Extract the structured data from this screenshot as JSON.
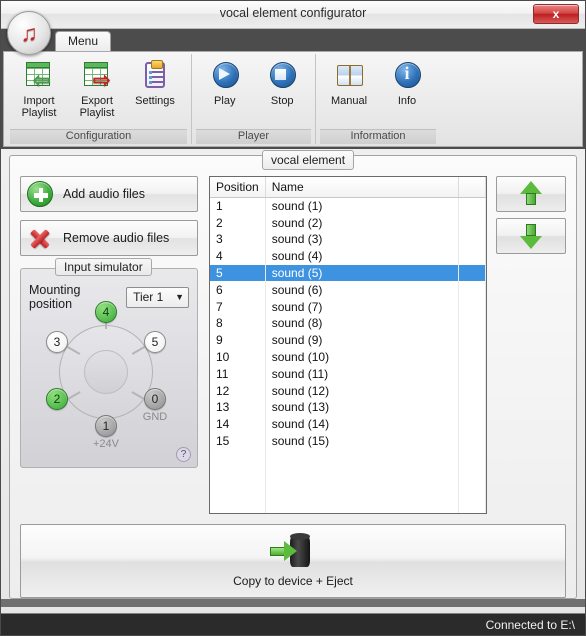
{
  "window": {
    "title": "vocal element configurator",
    "close_label": "x",
    "app_icon": "music-note-icon"
  },
  "ribbon": {
    "tab": "Menu",
    "groups": [
      {
        "title": "Configuration",
        "buttons": [
          {
            "label_line1": "Import",
            "label_line2": "Playlist",
            "icon": "import-playlist-icon"
          },
          {
            "label_line1": "Export",
            "label_line2": "Playlist",
            "icon": "export-playlist-icon"
          },
          {
            "label_line1": "Settings",
            "label_line2": "",
            "icon": "settings-clipboard-icon"
          }
        ]
      },
      {
        "title": "Player",
        "buttons": [
          {
            "label_line1": "Play",
            "label_line2": "",
            "icon": "play-icon"
          },
          {
            "label_line1": "Stop",
            "label_line2": "",
            "icon": "stop-icon"
          }
        ]
      },
      {
        "title": "Information",
        "buttons": [
          {
            "label_line1": "Manual",
            "label_line2": "",
            "icon": "book-icon"
          },
          {
            "label_line1": "Info",
            "label_line2": "",
            "icon": "info-icon"
          }
        ]
      }
    ]
  },
  "left_panel": {
    "add_button": "Add audio files",
    "remove_button": "Remove audio files",
    "input_simulator": {
      "legend": "Input simulator",
      "mounting_label": "Mounting position",
      "mounting_value": "Tier 1",
      "help_badge": "?",
      "nodes": [
        {
          "id": "4",
          "state": "on",
          "caption": ""
        },
        {
          "id": "3",
          "state": "off",
          "caption": ""
        },
        {
          "id": "5",
          "state": "off",
          "caption": ""
        },
        {
          "id": "2",
          "state": "on",
          "caption": ""
        },
        {
          "id": "0",
          "state": "gray",
          "caption": "GND"
        },
        {
          "id": "1",
          "state": "gray",
          "caption": "+24V"
        }
      ]
    }
  },
  "playlist": {
    "tab_caption": "vocal element",
    "columns": [
      "Position",
      "Name"
    ],
    "rows": [
      {
        "position": "1",
        "name": "sound (1)",
        "selected": false
      },
      {
        "position": "2",
        "name": "sound (2)",
        "selected": false
      },
      {
        "position": "3",
        "name": "sound (3)",
        "selected": false
      },
      {
        "position": "4",
        "name": "sound (4)",
        "selected": false
      },
      {
        "position": "5",
        "name": "sound (5)",
        "selected": true
      },
      {
        "position": "6",
        "name": "sound (6)",
        "selected": false
      },
      {
        "position": "7",
        "name": "sound (7)",
        "selected": false
      },
      {
        "position": "8",
        "name": "sound (8)",
        "selected": false
      },
      {
        "position": "9",
        "name": "sound (9)",
        "selected": false
      },
      {
        "position": "10",
        "name": "sound (10)",
        "selected": false
      },
      {
        "position": "11",
        "name": "sound (11)",
        "selected": false
      },
      {
        "position": "12",
        "name": "sound (12)",
        "selected": false
      },
      {
        "position": "13",
        "name": "sound (13)",
        "selected": false
      },
      {
        "position": "14",
        "name": "sound (14)",
        "selected": false
      },
      {
        "position": "15",
        "name": "sound (15)",
        "selected": false
      },
      {
        "position": "",
        "name": "",
        "selected": false
      },
      {
        "position": "",
        "name": "",
        "selected": false
      },
      {
        "position": "",
        "name": "",
        "selected": false
      },
      {
        "position": "",
        "name": "",
        "selected": false
      }
    ],
    "move_up_icon": "arrow-up-icon",
    "move_down_icon": "arrow-down-icon"
  },
  "copy_panel": {
    "label": "Copy to device + Eject",
    "icon": "copy-to-usb-device-icon"
  },
  "statusbar": {
    "text": "Connected to E:\\"
  },
  "colors": {
    "accent_selection": "#3d93e0",
    "green": "#5cbb3c",
    "red": "#c01f1f",
    "ribbon_bg": "#4c4c4c",
    "statusbar_bg": "#2b2b2b"
  }
}
